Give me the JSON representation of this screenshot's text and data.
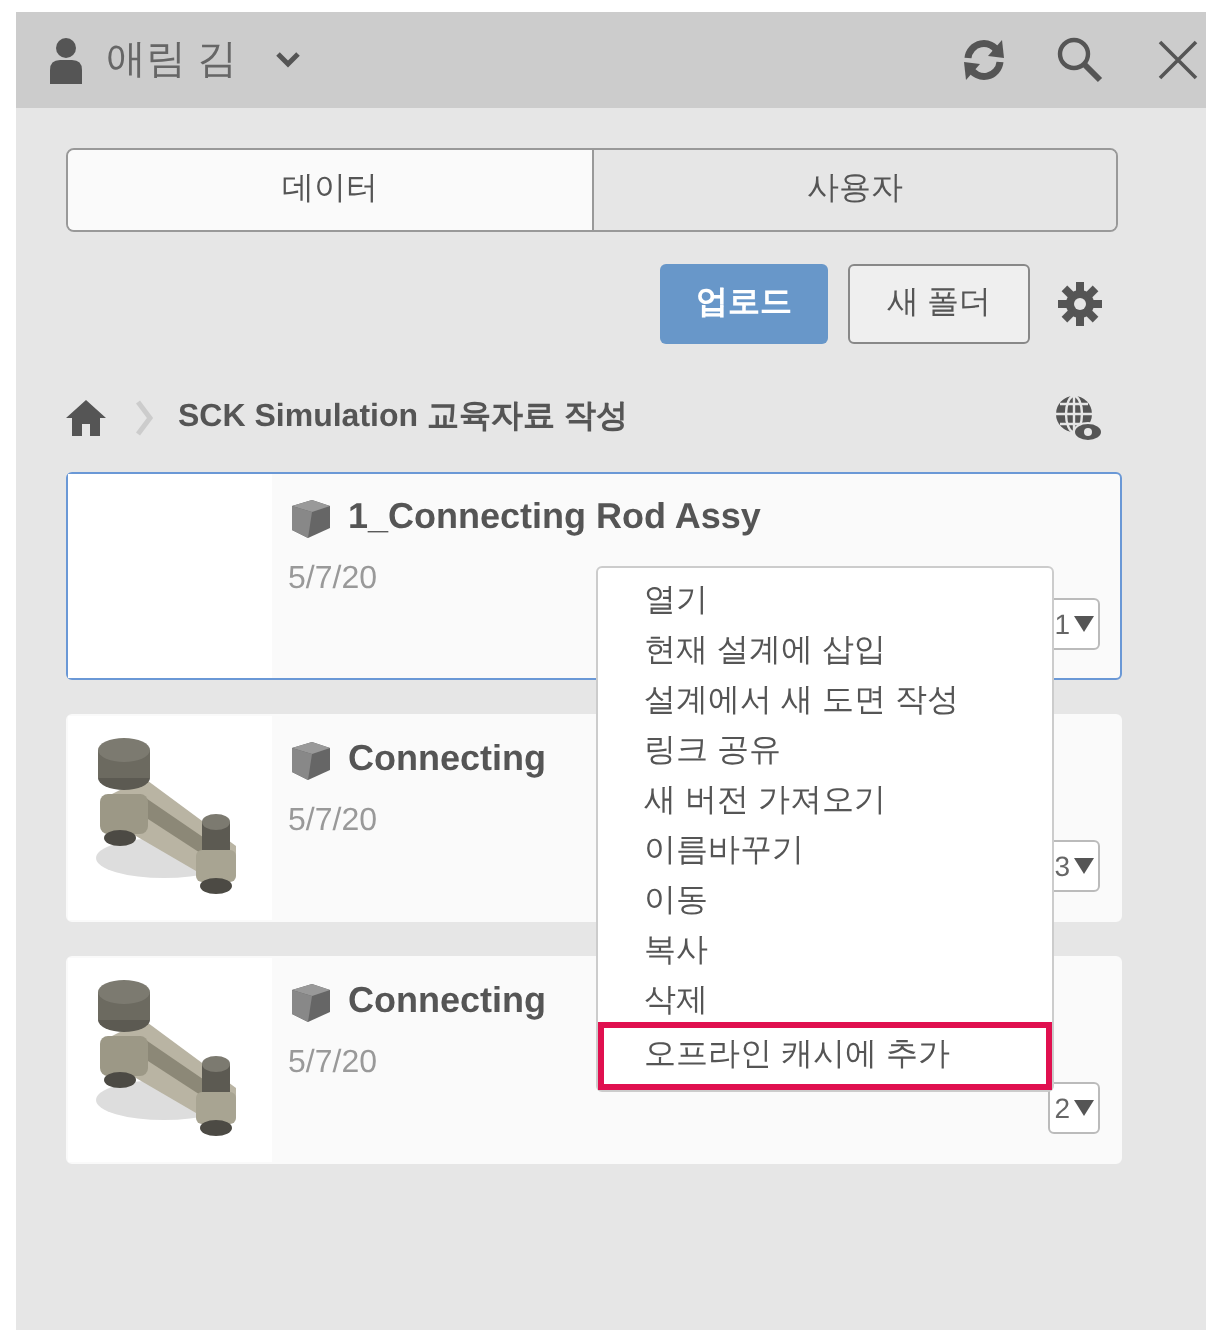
{
  "header": {
    "user_name": "애림 김"
  },
  "tabs": [
    {
      "label": "데이터",
      "selected": true
    },
    {
      "label": "사용자",
      "selected": false
    }
  ],
  "actions": {
    "upload": "업로드",
    "new_folder": "새 폴더"
  },
  "breadcrumb": {
    "path": "SCK Simulation 교육자료 작성"
  },
  "files": [
    {
      "name": "1_Connecting Rod Assy",
      "date": "5/7/20",
      "version": "1",
      "selected": true,
      "has_thumbnail": false
    },
    {
      "name": "Connecting",
      "date": "5/7/20",
      "version": "3",
      "selected": false,
      "has_thumbnail": true
    },
    {
      "name": "Connecting",
      "date": "5/7/20",
      "version": "2",
      "selected": false,
      "has_thumbnail": true
    }
  ],
  "context_menu": [
    {
      "label": "열기",
      "highlighted": false
    },
    {
      "label": "현재 설계에 삽입",
      "highlighted": false
    },
    {
      "label": "설계에서 새 도면 작성",
      "highlighted": false
    },
    {
      "label": "링크 공유",
      "highlighted": false
    },
    {
      "label": "새 버전 가져오기",
      "highlighted": false
    },
    {
      "label": "이름바꾸기",
      "highlighted": false
    },
    {
      "label": "이동",
      "highlighted": false
    },
    {
      "label": "복사",
      "highlighted": false
    },
    {
      "label": "삭제",
      "highlighted": false
    },
    {
      "label": "오프라인 캐시에 추가",
      "highlighted": true
    }
  ]
}
